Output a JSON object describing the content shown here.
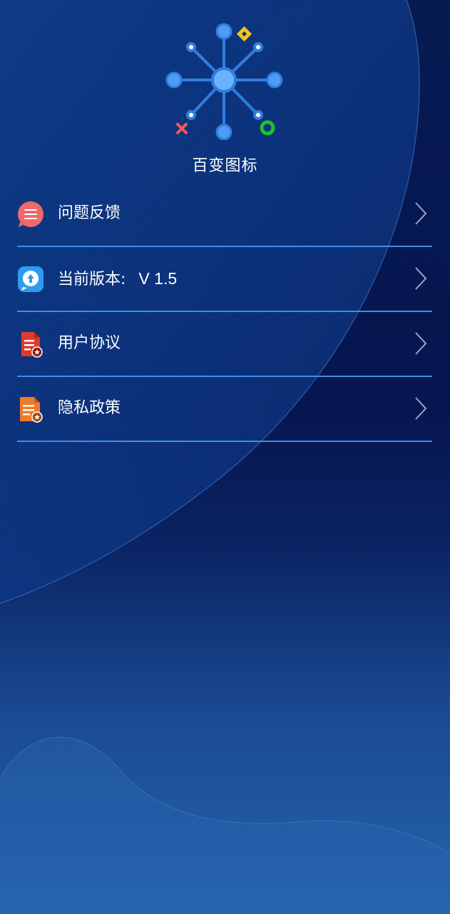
{
  "app": {
    "name": "百变图标"
  },
  "menu": {
    "items": [
      {
        "label": "问题反馈",
        "icon": "feedback-icon",
        "color": "#f0686a"
      },
      {
        "label": "当前版本:",
        "value": "V 1.5",
        "icon": "update-icon",
        "color": "#2d9cf0"
      },
      {
        "label": "用户协议",
        "icon": "agreement-icon",
        "color": "#e03a2e"
      },
      {
        "label": "隐私政策",
        "icon": "privacy-icon",
        "color": "#f07a2a"
      }
    ]
  },
  "colors": {
    "divider": "#3d8fe6",
    "logo_blue": "#2f7ee0",
    "accent_yellow": "#f5c21c",
    "accent_green": "#1ec22a",
    "accent_red": "#f25a5a"
  }
}
